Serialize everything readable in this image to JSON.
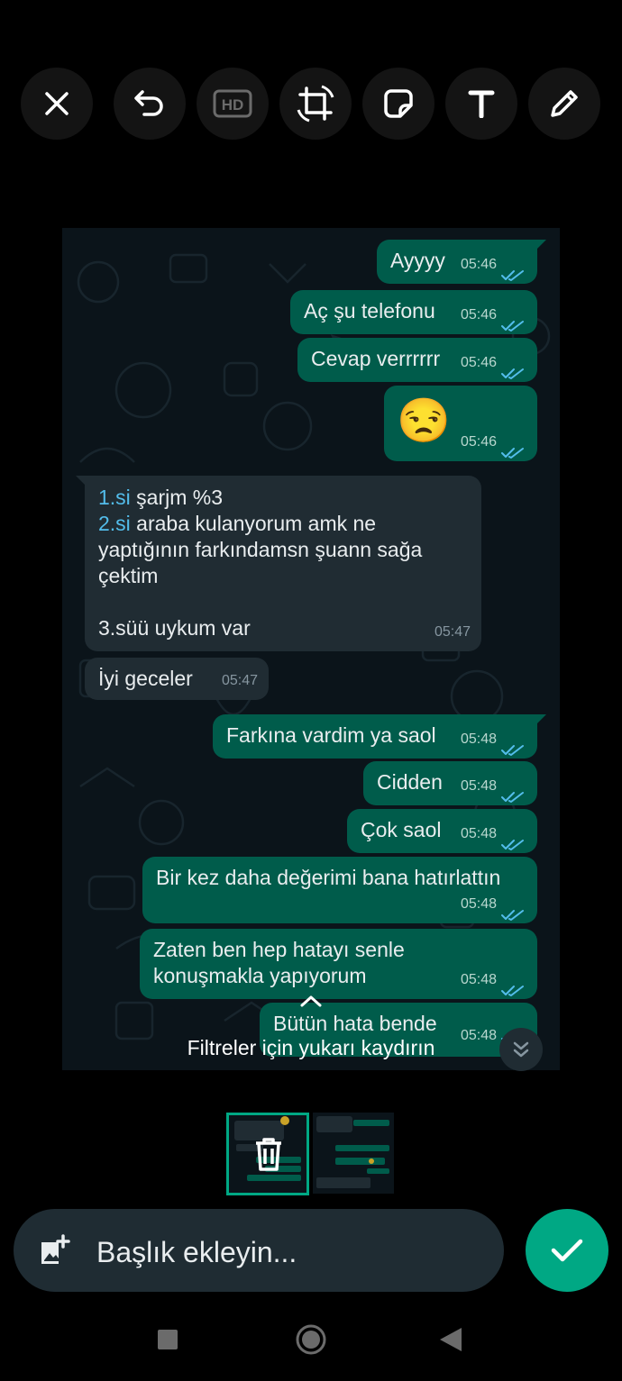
{
  "toolbar": {
    "icons": [
      "close-icon",
      "undo-icon",
      "hd-icon",
      "crop-rotate-icon",
      "sticker-icon",
      "text-icon",
      "pencil-icon"
    ]
  },
  "chat": {
    "messages": [
      {
        "dir": "out",
        "text": "Ayyyy",
        "time": "05:46",
        "read": true
      },
      {
        "dir": "out",
        "text": "Aç şu telefonu",
        "time": "05:46",
        "read": true
      },
      {
        "dir": "out",
        "text": "Cevap verrrrrr",
        "time": "05:46",
        "read": true
      },
      {
        "dir": "out",
        "text": "😒",
        "time": "05:46",
        "read": true
      },
      {
        "dir": "in",
        "lines": [
          {
            "num": "1.si",
            "rest": " şarjm %3"
          },
          {
            "num": "2.si",
            "rest": " araba kulanyorum amk ne"
          },
          {
            "num": "",
            "rest": "yaptığının farkındamsn şuann sağa"
          },
          {
            "num": "",
            "rest": "çektim"
          },
          {
            "num": "",
            "rest": ""
          },
          {
            "num": "",
            "rest": "3.süü uykum var"
          }
        ],
        "time": "05:47"
      },
      {
        "dir": "in",
        "text": "İyi geceler",
        "time": "05:47"
      },
      {
        "dir": "out",
        "text": "Farkına vardim ya saol",
        "time": "05:48",
        "read": true
      },
      {
        "dir": "out",
        "text": "Cidden",
        "time": "05:48",
        "read": true
      },
      {
        "dir": "out",
        "text": "Çok saol",
        "time": "05:48",
        "read": true
      },
      {
        "dir": "out",
        "text": "Bir kez daha değerimi bana hatırlattın",
        "time": "05:48",
        "read": true
      },
      {
        "dir": "out",
        "text": "Zaten ben hep hatayı senle\nkonuşmakla yapıyorum",
        "time": "05:48",
        "read": true
      },
      {
        "dir": "out",
        "text": "Bütün hata bende",
        "time": "05:48",
        "read": true
      }
    ]
  },
  "filter_hint": "Filtreler için yukarı kaydırın",
  "caption": {
    "placeholder": "Başlık ekleyin..."
  },
  "colors": {
    "outgoing": "#005c4b",
    "incoming": "#202c33",
    "accent": "#00a884",
    "read_tick": "#53bdeb"
  }
}
